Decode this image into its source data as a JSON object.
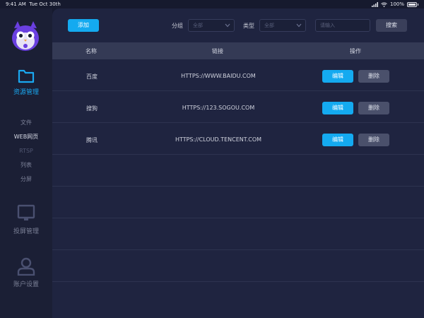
{
  "status_bar": {
    "time": "9:41 AM",
    "date": "Tue Oct 30th",
    "battery": "100%"
  },
  "sidebar": {
    "main_items": [
      {
        "label": "资源管理",
        "icon": "folder-icon",
        "active": true
      },
      {
        "label": "投屏管理",
        "icon": "monitor-icon",
        "active": false
      },
      {
        "label": "账户设置",
        "icon": "user-icon",
        "active": false
      }
    ],
    "sub_items": [
      {
        "label": "文件"
      },
      {
        "label": "WEB网页",
        "active": true
      },
      {
        "label": "RTSP"
      },
      {
        "label": "列表"
      },
      {
        "label": "分屏"
      }
    ]
  },
  "toolbar": {
    "add_label": "添加",
    "group_label": "分组",
    "group_value": "全部",
    "type_label": "类型",
    "type_value": "全部",
    "search_placeholder": "请输入",
    "search_label": "搜索"
  },
  "table": {
    "columns": [
      "名称",
      "链接",
      "操作"
    ],
    "rows": [
      {
        "name": "百度",
        "link": "HTTPS://WWW.BAIDU.COM",
        "edit": "编辑",
        "delete": "删除"
      },
      {
        "name": "搜狗",
        "link": "HTTPS://123.SOGOU.COM",
        "edit": "编辑",
        "delete": "删除"
      },
      {
        "name": "腾讯",
        "link": "HTTPS://CLOUD.TENCENT.COM",
        "edit": "编辑",
        "delete": "删除"
      }
    ]
  },
  "colors": {
    "accent": "#14aaf0",
    "background": "#1f2440",
    "sidebar": "#1b1f35"
  }
}
